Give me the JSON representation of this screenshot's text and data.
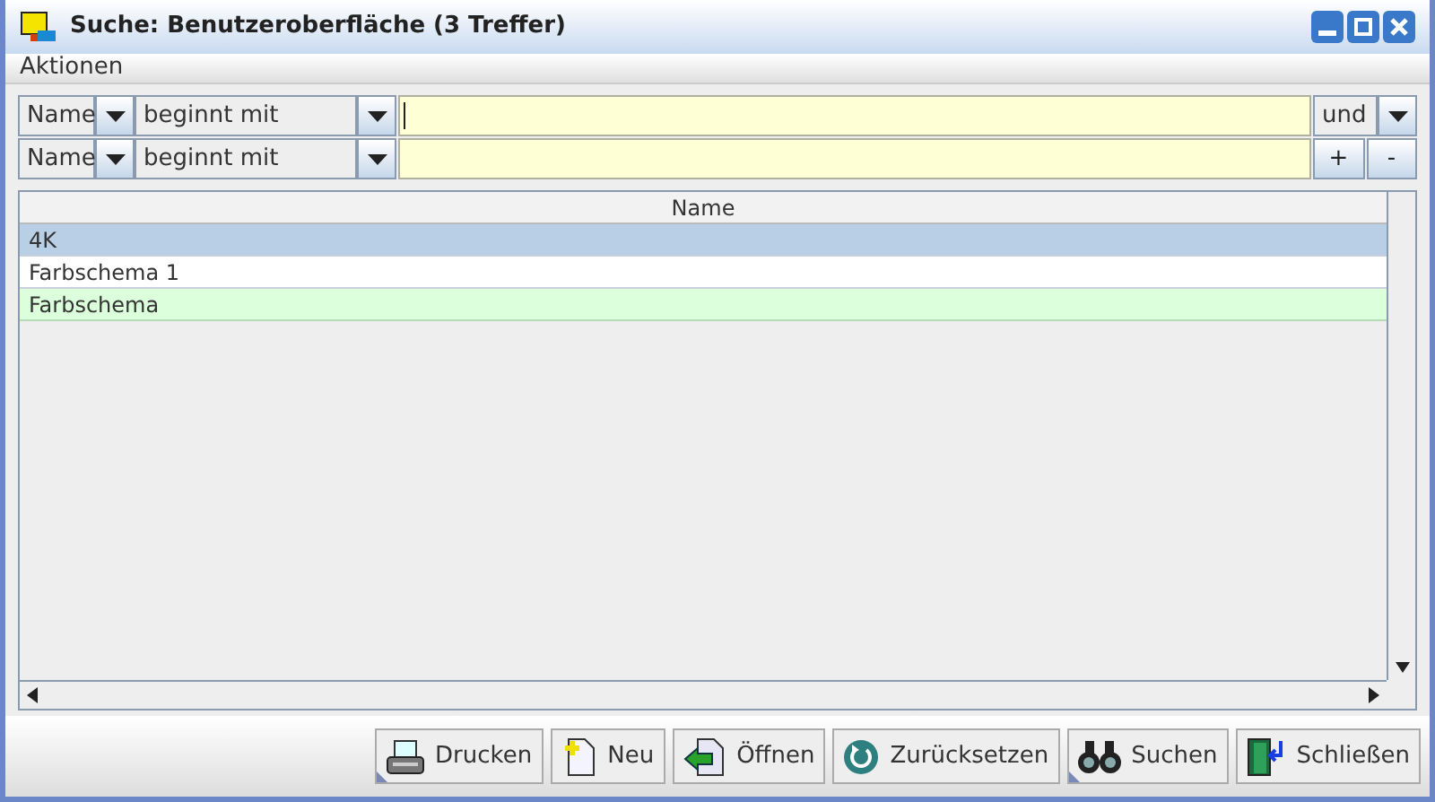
{
  "window": {
    "title": "Suche: Benutzeroberfläche (3 Treffer)"
  },
  "menu": [
    "Aktionen"
  ],
  "filters": [
    {
      "field": "Name",
      "operator": "beginnt mit",
      "focused": true,
      "kind": "conjunction",
      "conjunction": "und"
    },
    {
      "field": "Name",
      "operator": "beginnt mit",
      "focused": false,
      "kind": "addremove",
      "add": "+",
      "remove": "-"
    }
  ],
  "table": {
    "columns": [
      "Name"
    ],
    "rows": [
      {
        "name": "4K",
        "selected": true,
        "highlighted": false
      },
      {
        "name": "Farbschema 1",
        "selected": false,
        "highlighted": false
      },
      {
        "name": "Farbschema",
        "selected": false,
        "highlighted": true
      }
    ]
  },
  "buttons": [
    {
      "label": "Drucken",
      "kind": "printer",
      "menu": true
    },
    {
      "label": "Neu",
      "kind": "new",
      "menu": false
    },
    {
      "label": "Öffnen",
      "kind": "open",
      "menu": false
    },
    {
      "label": "Zurücksetzen",
      "kind": "reset",
      "menu": false
    },
    {
      "label": "Suchen",
      "kind": "binoculars",
      "menu": true
    },
    {
      "label": "Schließen",
      "kind": "exit",
      "menu": false
    }
  ]
}
